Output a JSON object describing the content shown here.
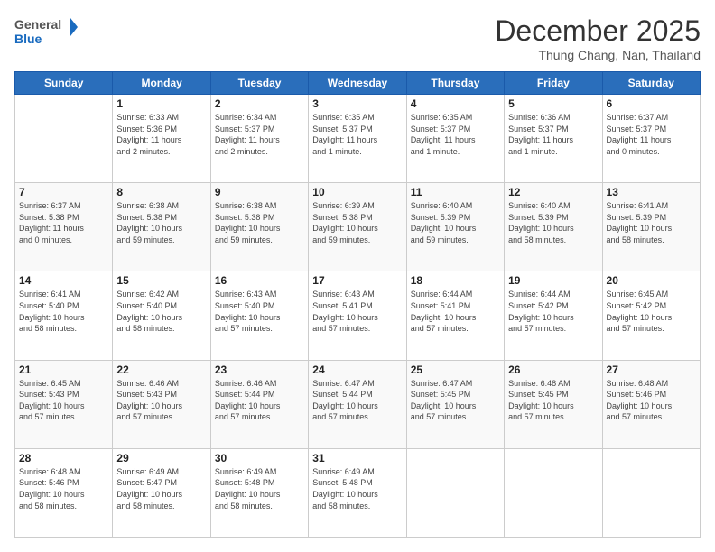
{
  "header": {
    "logo_general": "General",
    "logo_blue": "Blue",
    "month": "December 2025",
    "location": "Thung Chang, Nan, Thailand"
  },
  "weekdays": [
    "Sunday",
    "Monday",
    "Tuesday",
    "Wednesday",
    "Thursday",
    "Friday",
    "Saturday"
  ],
  "weeks": [
    [
      {
        "day": "",
        "text": ""
      },
      {
        "day": "1",
        "text": "Sunrise: 6:33 AM\nSunset: 5:36 PM\nDaylight: 11 hours\nand 2 minutes."
      },
      {
        "day": "2",
        "text": "Sunrise: 6:34 AM\nSunset: 5:37 PM\nDaylight: 11 hours\nand 2 minutes."
      },
      {
        "day": "3",
        "text": "Sunrise: 6:35 AM\nSunset: 5:37 PM\nDaylight: 11 hours\nand 1 minute."
      },
      {
        "day": "4",
        "text": "Sunrise: 6:35 AM\nSunset: 5:37 PM\nDaylight: 11 hours\nand 1 minute."
      },
      {
        "day": "5",
        "text": "Sunrise: 6:36 AM\nSunset: 5:37 PM\nDaylight: 11 hours\nand 1 minute."
      },
      {
        "day": "6",
        "text": "Sunrise: 6:37 AM\nSunset: 5:37 PM\nDaylight: 11 hours\nand 0 minutes."
      }
    ],
    [
      {
        "day": "7",
        "text": "Sunrise: 6:37 AM\nSunset: 5:38 PM\nDaylight: 11 hours\nand 0 minutes."
      },
      {
        "day": "8",
        "text": "Sunrise: 6:38 AM\nSunset: 5:38 PM\nDaylight: 10 hours\nand 59 minutes."
      },
      {
        "day": "9",
        "text": "Sunrise: 6:38 AM\nSunset: 5:38 PM\nDaylight: 10 hours\nand 59 minutes."
      },
      {
        "day": "10",
        "text": "Sunrise: 6:39 AM\nSunset: 5:38 PM\nDaylight: 10 hours\nand 59 minutes."
      },
      {
        "day": "11",
        "text": "Sunrise: 6:40 AM\nSunset: 5:39 PM\nDaylight: 10 hours\nand 59 minutes."
      },
      {
        "day": "12",
        "text": "Sunrise: 6:40 AM\nSunset: 5:39 PM\nDaylight: 10 hours\nand 58 minutes."
      },
      {
        "day": "13",
        "text": "Sunrise: 6:41 AM\nSunset: 5:39 PM\nDaylight: 10 hours\nand 58 minutes."
      }
    ],
    [
      {
        "day": "14",
        "text": "Sunrise: 6:41 AM\nSunset: 5:40 PM\nDaylight: 10 hours\nand 58 minutes."
      },
      {
        "day": "15",
        "text": "Sunrise: 6:42 AM\nSunset: 5:40 PM\nDaylight: 10 hours\nand 58 minutes."
      },
      {
        "day": "16",
        "text": "Sunrise: 6:43 AM\nSunset: 5:40 PM\nDaylight: 10 hours\nand 57 minutes."
      },
      {
        "day": "17",
        "text": "Sunrise: 6:43 AM\nSunset: 5:41 PM\nDaylight: 10 hours\nand 57 minutes."
      },
      {
        "day": "18",
        "text": "Sunrise: 6:44 AM\nSunset: 5:41 PM\nDaylight: 10 hours\nand 57 minutes."
      },
      {
        "day": "19",
        "text": "Sunrise: 6:44 AM\nSunset: 5:42 PM\nDaylight: 10 hours\nand 57 minutes."
      },
      {
        "day": "20",
        "text": "Sunrise: 6:45 AM\nSunset: 5:42 PM\nDaylight: 10 hours\nand 57 minutes."
      }
    ],
    [
      {
        "day": "21",
        "text": "Sunrise: 6:45 AM\nSunset: 5:43 PM\nDaylight: 10 hours\nand 57 minutes."
      },
      {
        "day": "22",
        "text": "Sunrise: 6:46 AM\nSunset: 5:43 PM\nDaylight: 10 hours\nand 57 minutes."
      },
      {
        "day": "23",
        "text": "Sunrise: 6:46 AM\nSunset: 5:44 PM\nDaylight: 10 hours\nand 57 minutes."
      },
      {
        "day": "24",
        "text": "Sunrise: 6:47 AM\nSunset: 5:44 PM\nDaylight: 10 hours\nand 57 minutes."
      },
      {
        "day": "25",
        "text": "Sunrise: 6:47 AM\nSunset: 5:45 PM\nDaylight: 10 hours\nand 57 minutes."
      },
      {
        "day": "26",
        "text": "Sunrise: 6:48 AM\nSunset: 5:45 PM\nDaylight: 10 hours\nand 57 minutes."
      },
      {
        "day": "27",
        "text": "Sunrise: 6:48 AM\nSunset: 5:46 PM\nDaylight: 10 hours\nand 57 minutes."
      }
    ],
    [
      {
        "day": "28",
        "text": "Sunrise: 6:48 AM\nSunset: 5:46 PM\nDaylight: 10 hours\nand 58 minutes."
      },
      {
        "day": "29",
        "text": "Sunrise: 6:49 AM\nSunset: 5:47 PM\nDaylight: 10 hours\nand 58 minutes."
      },
      {
        "day": "30",
        "text": "Sunrise: 6:49 AM\nSunset: 5:48 PM\nDaylight: 10 hours\nand 58 minutes."
      },
      {
        "day": "31",
        "text": "Sunrise: 6:49 AM\nSunset: 5:48 PM\nDaylight: 10 hours\nand 58 minutes."
      },
      {
        "day": "",
        "text": ""
      },
      {
        "day": "",
        "text": ""
      },
      {
        "day": "",
        "text": ""
      }
    ]
  ]
}
